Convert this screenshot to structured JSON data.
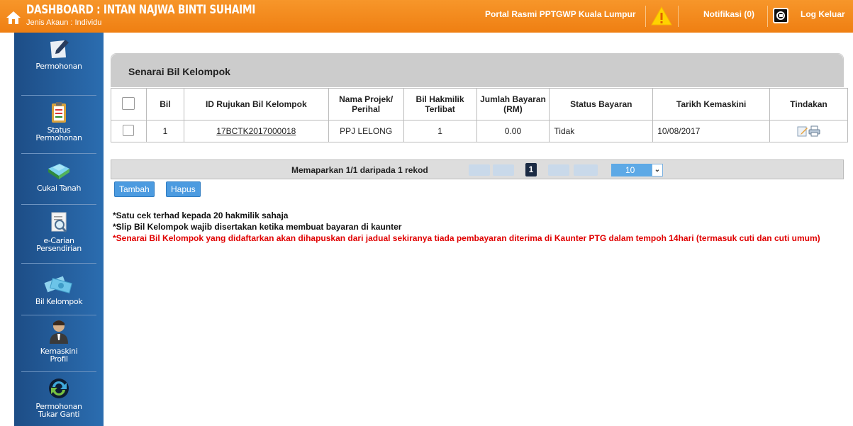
{
  "header": {
    "title": "DASHBOARD : INTAN NAJWA BINTI SUHAIMI",
    "account_type": "Jenis Akaun : Individu",
    "portal": "Portal Rasmi PPTGWP Kuala Lumpur",
    "notifications": "Notifikasi (0)",
    "logout": "Log Keluar",
    "brand_color": "#f08a1c"
  },
  "sidebar": {
    "items": [
      {
        "label": "Permohonan",
        "icon": "pen-paper-icon"
      },
      {
        "label": "Status Permohonan",
        "icon": "clipboard-checklist-icon"
      },
      {
        "label": "Cukai Tanah",
        "icon": "land-tax-icon"
      },
      {
        "label": "e-Carian Persendirian",
        "icon": "document-search-icon"
      },
      {
        "label": "Bil Kelompok",
        "icon": "money-bills-icon"
      },
      {
        "label": "Kemaskini Profil",
        "icon": "user-profile-icon"
      },
      {
        "label": "Permohonan Tukar Ganti",
        "icon": "exchange-arrows-icon"
      }
    ]
  },
  "panel": {
    "title": "Senarai Bil Kelompok"
  },
  "table": {
    "headers": [
      "Bil",
      "ID Rujukan Bil Kelompok",
      "Nama Projek/ Perihal",
      "Bil Hakmilik Terlibat",
      "Jumlah Bayaran (RM)",
      "Status Bayaran",
      "Tarikh Kemaskini",
      "Tindakan"
    ],
    "rows": [
      {
        "bil": "1",
        "id": "17BCTK2017000018",
        "nama": "PPJ LELONG",
        "hakmilik": "1",
        "jumlah": "0.00",
        "status": "Tidak",
        "tarikh": "10/08/2017"
      }
    ]
  },
  "pager": {
    "info": "Memaparkan 1/1 daripada 1 rekod",
    "current_page": "1",
    "page_size": "10"
  },
  "buttons": {
    "add": "Tambah",
    "delete": "Hapus"
  },
  "notes": {
    "note1": "*Satu cek terhad kepada 20 hakmilik sahaja",
    "note2": "*Slip Bil Kelompok wajib disertakan ketika membuat bayaran di kaunter",
    "note3": "*Senarai Bil Kelompok yang didaftarkan akan dihapuskan dari jadual sekiranya tiada pembayaran diterima di Kaunter PTG dalam tempoh 14hari (termasuk cuti dan cuti umum)"
  }
}
